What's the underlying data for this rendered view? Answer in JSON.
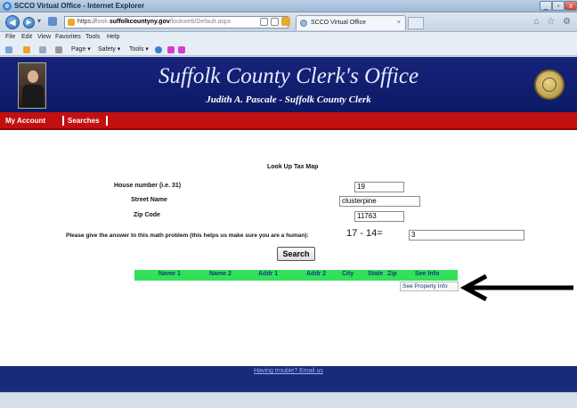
{
  "window": {
    "title": "SCCO Virtual Office - Internet Explorer",
    "min": "_",
    "max": "▫",
    "close": "x"
  },
  "browser": {
    "back_icon": "back-arrow-icon",
    "forward_icon": "forward-arrow-icon",
    "url_prefix": "https://",
    "url_domain_dim": "look.",
    "url_domain": "suffolkcountyny.gov",
    "url_path": "/lookweb/Default.aspx",
    "tab_label": "SCCO Virtual Office",
    "tab_close": "×",
    "top_right_icons": "⌂ ☆ ⚙"
  },
  "menubar": [
    "File",
    "Edit",
    "View",
    "Favorites",
    "Tools",
    "Help"
  ],
  "commandbar": [
    "Page ▾",
    "Safety ▾",
    "Tools ▾"
  ],
  "banner": {
    "title": "Suffolk County Clerk's Office",
    "subtitle": "Judith A. Pascale - Suffolk County Clerk"
  },
  "nav": {
    "my_account": "My Account",
    "searches": "Searches"
  },
  "form": {
    "title": "Look Up Tax Map",
    "house_number_label": "House number (i.e. 31)",
    "house_number_value": "19",
    "street_name_label": "Street Name",
    "street_name_value": "clusterpine",
    "zip_label": "Zip Code",
    "zip_value": "11763",
    "math_label": "Please give the answer to this math problem (this helps us make sure you are a human):",
    "math_problem": "17 - 14=",
    "math_answer": "3",
    "search_button": "Search"
  },
  "results_grid": {
    "columns": [
      "Name 1",
      "Name 2",
      "Addr 1",
      "Addr 2",
      "City",
      "State",
      "Zip",
      "See Info"
    ],
    "link_label": "See Property Info",
    "header_color": "#33e05a"
  },
  "footer": {
    "help_link": "Having trouble? Email us"
  },
  "colors": {
    "banner": "#16237a",
    "nav_bar": "#c21010"
  }
}
